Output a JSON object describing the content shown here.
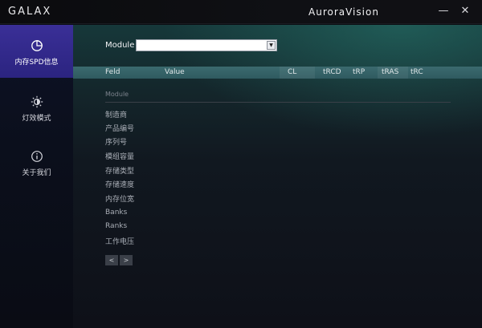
{
  "titlebar": {
    "logo": "GALAX",
    "app_name": "AuroraVision",
    "minimize_glyph": "—",
    "close_glyph": "✕"
  },
  "sidebar": {
    "items": [
      {
        "label": "内存SPD信息",
        "icon": "pie-chart-icon",
        "active": true
      },
      {
        "label": "灯效模式",
        "icon": "brightness-icon",
        "active": false
      },
      {
        "label": "关于我们",
        "icon": "info-icon",
        "active": false
      }
    ]
  },
  "module": {
    "label": "Module",
    "selected": ""
  },
  "table": {
    "headers": [
      "Feld",
      "Value",
      "CL",
      "tRCD",
      "tRP",
      "tRAS",
      "tRC"
    ]
  },
  "section": {
    "title": "Module",
    "rows": [
      "制造商",
      "产品编号",
      "序列号",
      "模组容量",
      "存储类型",
      "存储速度",
      "内存位宽",
      "Banks",
      "Ranks",
      "工作电压"
    ]
  },
  "pager": {
    "prev": "<",
    "next": ">"
  },
  "colors": {
    "accent": "#3a2f97",
    "header": "#3b6a6e"
  }
}
